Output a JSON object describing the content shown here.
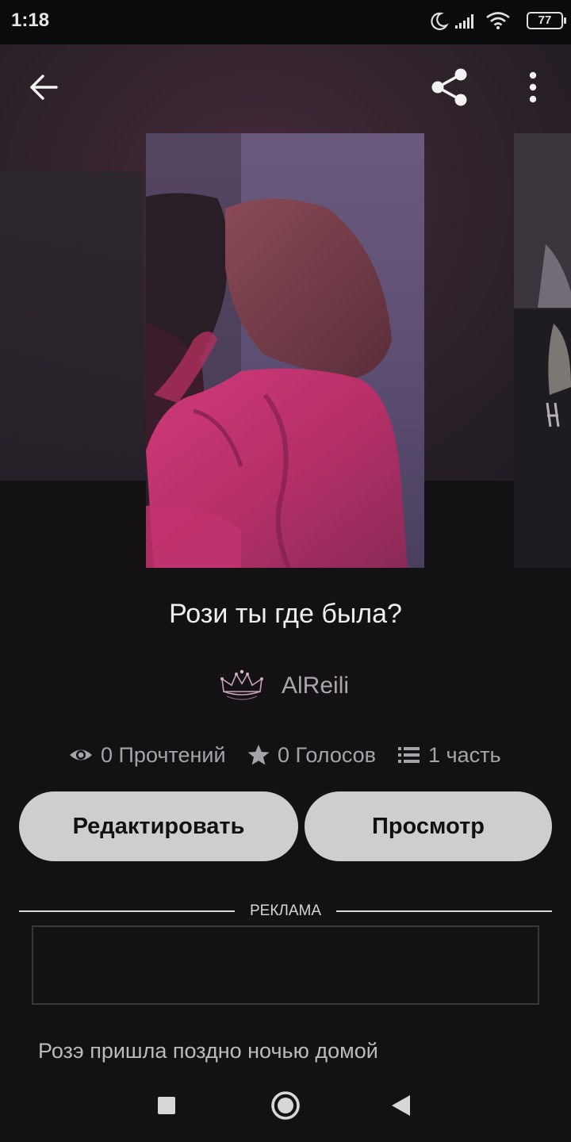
{
  "status_bar": {
    "time": "1:18",
    "battery": "77",
    "icons": [
      "moon-icon",
      "signal-icon",
      "wifi-icon",
      "battery-icon"
    ]
  },
  "toolbar": {
    "back_icon": "arrow-left-icon",
    "share_icon": "share-icon",
    "more_icon": "more-vertical-icon"
  },
  "story": {
    "title": "Рози ты где была?",
    "author": "AlReili",
    "stats": {
      "reads": "0 Прочтений",
      "votes": "0 Голосов",
      "parts": "1 часть"
    },
    "description": "Розэ пришла поздно ночью домой"
  },
  "actions": {
    "edit_label": "Редактировать",
    "view_label": "Просмотр"
  },
  "ad": {
    "label": "РЕКЛАМА"
  },
  "nav": {
    "icons": [
      "recents-square-icon",
      "home-circle-icon",
      "back-triangle-icon"
    ]
  },
  "colors": {
    "background": "#141114",
    "button": "#cfcdd0",
    "text_muted": "#a7a4a9",
    "cover_pink": "#c0306a"
  }
}
